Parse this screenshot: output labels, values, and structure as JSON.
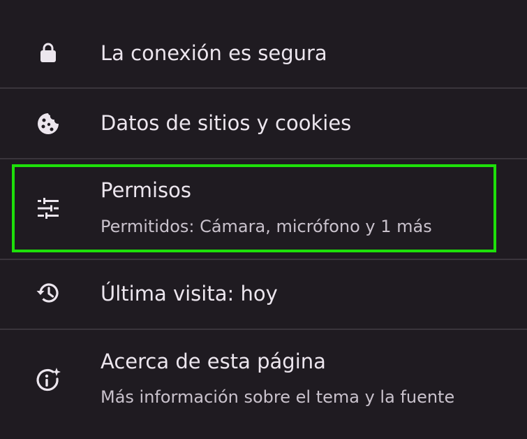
{
  "rows": [
    {
      "icon": "lock-icon",
      "title": "La conexión es segura"
    },
    {
      "icon": "cookie-icon",
      "title": "Datos de sitios y cookies"
    },
    {
      "icon": "tune-sliders-icon",
      "title": "Permisos",
      "subtitle": "Permitidos: Cámara, micrófono y 1 más"
    },
    {
      "icon": "history-icon",
      "title": "Última visita: hoy"
    },
    {
      "icon": "info-sparkle-icon",
      "title": "Acerca de esta página",
      "subtitle": "Más información sobre el tema y la fuente"
    }
  ],
  "colors": {
    "background": "#1f1b21",
    "divider": "#3a353c",
    "text_primary": "#ece6ee",
    "text_secondary": "#c9c2cc",
    "highlight": "#1ee00a"
  }
}
